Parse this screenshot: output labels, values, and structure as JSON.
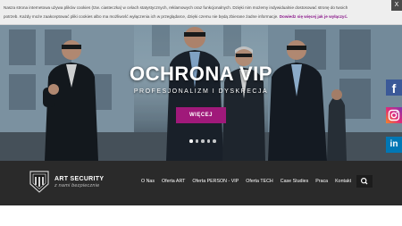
{
  "cookie_bar": {
    "text_line1": "Nasza strona internetowa używa plików cookies (tzw. ciasteczka) w celach statystycznych, reklamowych oraz funkcjonalnych. Dzięki nim możemy indywidualnie dostosować stronę do twoich",
    "text_line2": "potrzeb. Każdy może zaakceptować pliki cookies albo ma możliwość wyłączenia ich w przeglądarce, dzięki czemu nie będą zbierane żadne informacje.",
    "link_label": "Dowiedz się więcej jak je wyłączyć.",
    "close_label": "X"
  },
  "hero": {
    "title": "OCHRONA VIP",
    "subtitle": "PROFESJONALIZM I DYSKRECJA",
    "button_label": "WIĘCEJ",
    "slide_count": 5,
    "active_slide": 1
  },
  "social": {
    "facebook_glyph": "f",
    "linkedin_glyph": "in"
  },
  "header": {
    "brand": "ART SECURITY",
    "tagline": "z nami bezpiecznie",
    "menu": [
      "O Nas",
      "Oferta ART",
      "Oferta PERSON - VIP",
      "Oferta TECH",
      "Case Studies",
      "Praca",
      "Kontakt"
    ]
  },
  "colors": {
    "accent": "#a0197a",
    "navbar": "#2a2a2a",
    "facebook": "#3b5998",
    "linkedin": "#0077b5"
  }
}
